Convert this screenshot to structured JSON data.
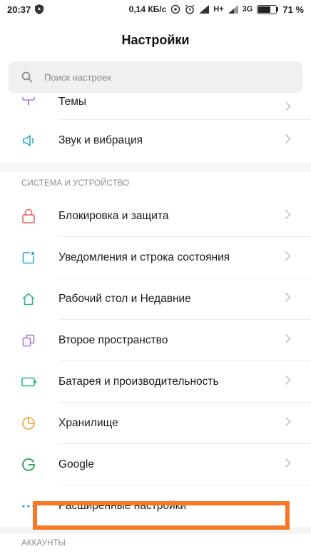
{
  "status": {
    "time": "20:37",
    "speed": "0,14 КБ/с",
    "network_h": "H+",
    "network_3g": "3G",
    "battery": "71 %",
    "battery_level": 0.71
  },
  "header": {
    "title": "Настройки"
  },
  "search": {
    "placeholder": "Поиск настроек"
  },
  "top_items": [
    {
      "label": "Темы",
      "icon": "themes-icon"
    },
    {
      "label": "Звук и вибрация",
      "icon": "speaker-icon"
    }
  ],
  "section_system": {
    "header": "СИСТЕМА И УСТРОЙСТВО",
    "items": [
      {
        "label": "Блокировка и защита",
        "icon": "lock-icon"
      },
      {
        "label": "Уведомления и строка состояния",
        "icon": "notification-icon"
      },
      {
        "label": "Рабочий стол и Недавние",
        "icon": "home-icon"
      },
      {
        "label": "Второе пространство",
        "icon": "second-space-icon"
      },
      {
        "label": "Батарея и производительность",
        "icon": "battery-icon"
      },
      {
        "label": "Хранилище",
        "icon": "storage-icon"
      },
      {
        "label": "Google",
        "icon": "google-icon"
      },
      {
        "label": "Расширенные настройки",
        "icon": "more-icon"
      }
    ]
  },
  "section_accounts": {
    "header": "АККАУНТЫ"
  },
  "colors": {
    "accent_highlight": "#f47a2a",
    "lock": "#e8626a",
    "notification": "#2aa9d9",
    "home": "#35b58a",
    "second_space": "#a47bd8",
    "battery": "#28b78a",
    "storage": "#f0a030",
    "google": "#3aa55d"
  }
}
